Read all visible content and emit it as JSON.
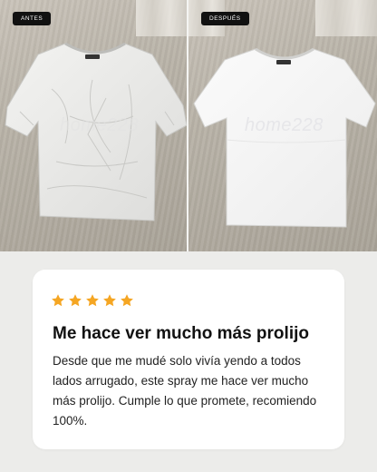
{
  "before_label": "ANTES",
  "after_label": "DESPUÉS",
  "watermark": "home228",
  "review": {
    "rating": 5,
    "rating_max": 5,
    "star_color": "#f5a623",
    "title": "Me hace ver mucho más prolijo",
    "body": "Desde que me mudé solo vivía yendo a todos lados arrugado, este spray me hace ver mucho más prolijo. Cumple lo que promete, recomiendo 100%."
  }
}
